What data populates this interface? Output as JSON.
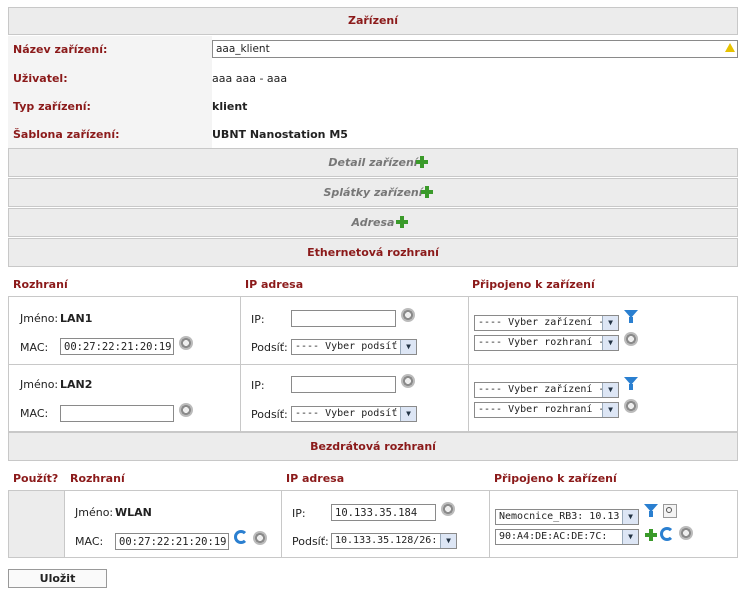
{
  "device": {
    "section_title": "Zařízení",
    "name_label": "Název zařízení:",
    "name_value": "aaa_klient",
    "user_label": "Uživatel:",
    "user_value": "aaa aaa - aaa",
    "type_label": "Typ zařízení:",
    "type_value": "klient",
    "template_label": "Šablona zařízení:",
    "template_value": "UBNT Nanostation M5"
  },
  "collapsibles": {
    "detail": "Detail zařízení",
    "installments": "Splátky zařízení",
    "address": "Adresa"
  },
  "ethernet": {
    "title": "Ethernetová rozhraní",
    "col_interface": "Rozhraní",
    "col_ip": "IP adresa",
    "col_connected": "Připojeno k zařízení",
    "rows": [
      {
        "name_label": "Jméno:",
        "name": "LAN1",
        "mac_label": "MAC:",
        "mac": "00:27:22:21:20:19",
        "ip_label": "IP:",
        "ip": "",
        "subnet_label": "Podsíť:",
        "subnet": "---- Vyber podsíť --",
        "device_select": "---- Vyber zařízení ----",
        "iface_select": "---- Vyber rozhraní ---"
      },
      {
        "name_label": "Jméno:",
        "name": "LAN2",
        "mac_label": "MAC:",
        "mac": "",
        "ip_label": "IP:",
        "ip": "",
        "subnet_label": "Podsíť:",
        "subnet": "---- Vyber podsíť --",
        "device_select": "---- Vyber zařízení ----",
        "iface_select": "---- Vyber rozhraní ---"
      }
    ]
  },
  "wireless": {
    "title": "Bezdrátová rozhraní",
    "col_use": "Použít?",
    "col_interface": "Rozhraní",
    "col_ip": "IP adresa",
    "col_connected": "Připojeno k zařízení",
    "row": {
      "name_label": "Jméno:",
      "name": "WLAN",
      "mac_label": "MAC:",
      "mac": "00:27:22:21:20:19",
      "ip_label": "IP:",
      "ip": "10.133.35.184",
      "subnet_label": "Podsíť:",
      "subnet": "10.133.35.128/26:",
      "device_select": "Nemocnice_RB3: 10.13",
      "iface_select": "90:A4:DE:AC:DE:7C:"
    }
  },
  "save_label": "Uložit",
  "icons": {
    "gear": "gear-icon",
    "plus": "plus-icon",
    "filter": "filter-icon",
    "refresh": "refresh-icon",
    "search": "search-icon",
    "warning": "warning-icon"
  },
  "colors": {
    "label_red": "#8b1a1a",
    "header_bg": "#ececec",
    "plus_green": "#3a9a2a",
    "filter_blue": "#2a7fd0"
  }
}
